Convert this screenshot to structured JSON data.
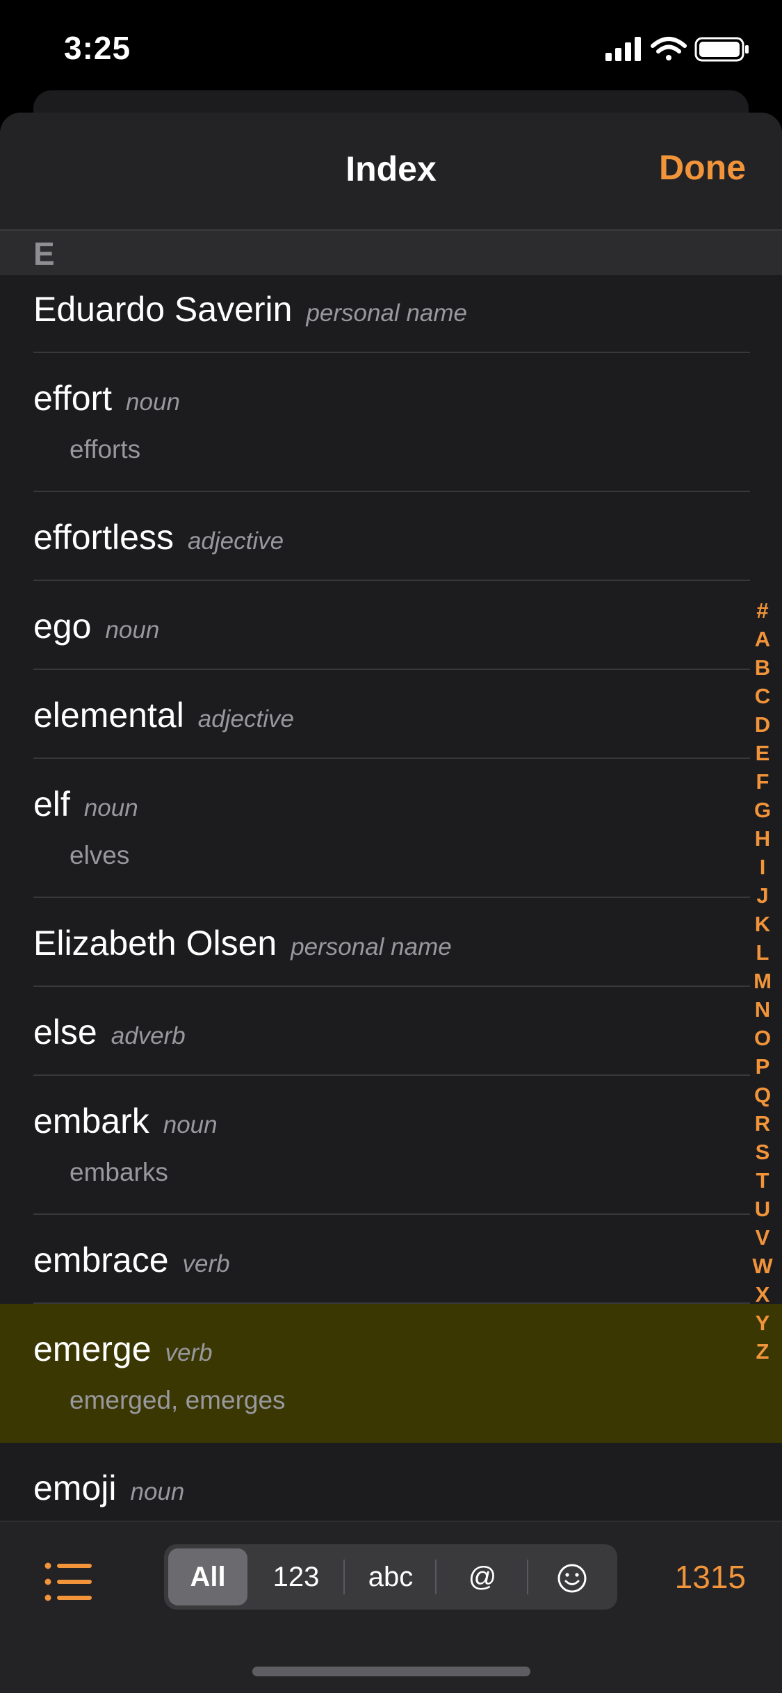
{
  "status_bar": {
    "time": "3:25"
  },
  "header": {
    "title": "Index",
    "done_label": "Done"
  },
  "section": {
    "letter": "E"
  },
  "entries": [
    {
      "word": "Eduardo Saverin",
      "pos": "personal name",
      "forms": ""
    },
    {
      "word": "effort",
      "pos": "noun",
      "forms": "efforts"
    },
    {
      "word": "effortless",
      "pos": "adjective",
      "forms": ""
    },
    {
      "word": "ego",
      "pos": "noun",
      "forms": ""
    },
    {
      "word": "elemental",
      "pos": "adjective",
      "forms": ""
    },
    {
      "word": "elf",
      "pos": "noun",
      "forms": "elves"
    },
    {
      "word": "Elizabeth Olsen",
      "pos": "personal name",
      "forms": ""
    },
    {
      "word": "else",
      "pos": "adverb",
      "forms": ""
    },
    {
      "word": "embark",
      "pos": "noun",
      "forms": "embarks"
    },
    {
      "word": "embrace",
      "pos": "verb",
      "forms": ""
    },
    {
      "word": "emerge",
      "pos": "verb",
      "forms": "emerged, emerges",
      "highlighted": true
    },
    {
      "word": "emoji",
      "pos": "noun",
      "forms": ""
    }
  ],
  "alphabet_index": [
    "#",
    "A",
    "B",
    "C",
    "D",
    "E",
    "F",
    "G",
    "H",
    "I",
    "J",
    "K",
    "L",
    "M",
    "N",
    "O",
    "P",
    "Q",
    "R",
    "S",
    "T",
    "U",
    "V",
    "W",
    "X",
    "Y",
    "Z"
  ],
  "toolbar": {
    "list_icon": "list-icon",
    "segments": [
      {
        "label": "All",
        "selected": true
      },
      {
        "label": "123",
        "selected": false
      },
      {
        "label": "abc",
        "selected": false
      },
      {
        "label": "@",
        "selected": false
      },
      {
        "label": "☺",
        "icon": "smiley-icon",
        "selected": false
      }
    ],
    "count": "1315"
  },
  "colors": {
    "accent": "#f2943a",
    "background": "#1c1c1e",
    "highlight_row": "#3a3703",
    "secondary_text": "#98989d"
  }
}
